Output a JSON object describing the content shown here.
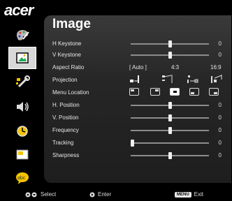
{
  "brand": "acer",
  "menu": {
    "title": "Image"
  },
  "sidebar": {
    "items": [
      {
        "name": "color",
        "icon": "palette-icon"
      },
      {
        "name": "image",
        "icon": "picture-icon",
        "active": true
      },
      {
        "name": "management",
        "icon": "wrench-icon"
      },
      {
        "name": "audio",
        "icon": "speaker-icon"
      },
      {
        "name": "timer",
        "icon": "clock-icon"
      },
      {
        "name": "display",
        "icon": "screen-icon"
      },
      {
        "name": "language",
        "icon": "language-icon"
      }
    ]
  },
  "settings": {
    "h_keystone": {
      "label": "H Keystone",
      "value": "0",
      "level": 0.5
    },
    "v_keystone": {
      "label": "V Keystone",
      "value": "0",
      "level": 0.5
    },
    "aspect_ratio": {
      "label": "Aspect Ratio",
      "options": [
        "[ Auto ]",
        "4:3",
        "16:9"
      ]
    },
    "projection": {
      "label": "Projection"
    },
    "menu_location": {
      "label": "Menu Location"
    },
    "h_position": {
      "label": "H. Position",
      "value": "0",
      "level": 0.5
    },
    "v_position": {
      "label": "V. Position",
      "value": "0",
      "level": 0.5
    },
    "frequency": {
      "label": "Frequency",
      "value": "0",
      "level": 0.5
    },
    "tracking": {
      "label": "Tracking",
      "value": "0",
      "level": 0.0
    },
    "sharpness": {
      "label": "Sharpness",
      "value": "0",
      "level": 0.5
    }
  },
  "footer": {
    "select_label": "Select",
    "enter_label": "Enter",
    "menu_key": "MENU",
    "exit_label": "Exit"
  }
}
